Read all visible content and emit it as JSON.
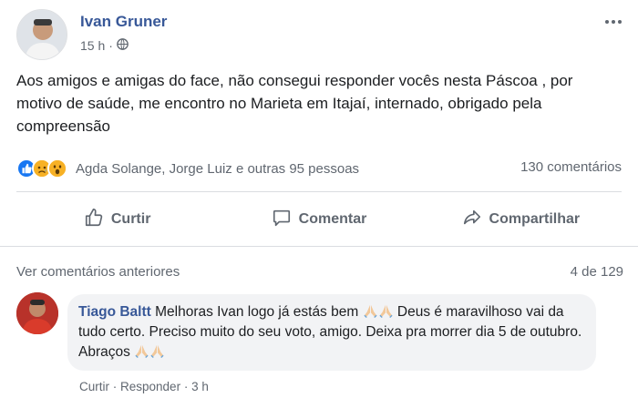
{
  "post": {
    "author": "Ivan Gruner",
    "time": "15 h",
    "privacy_icon": "globe-icon",
    "text": "Aos amigos e amigas do face, não consegui responder vocês nesta Páscoa , por motivo de saúde, me encontro no Marieta em Itajaí, internado, obrigado pela compreensão",
    "reaction_names": "Agda Solange, Jorge Luiz e outras 95 pessoas",
    "comment_count": "130 comentários"
  },
  "actions": {
    "like": "Curtir",
    "comment": "Comentar",
    "share": "Compartilhar"
  },
  "comments": {
    "previous_link": "Ver comentários anteriores",
    "pager": "4 de 129",
    "items": [
      {
        "author": "Tiago Baltt",
        "text_1": "Melhoras Ivan logo já estás bem",
        "text_2": "Deus é maravilhoso vai da tudo certo. Preciso muito do seu voto, amigo. Deixa pra morrer dia 5 de outubro. Abraços",
        "like": "Curtir",
        "reply": "Responder",
        "time": "3 h"
      }
    ]
  },
  "colors": {
    "link": "#385898",
    "secondary_text": "#606770",
    "like_blue": "#1877f2"
  }
}
